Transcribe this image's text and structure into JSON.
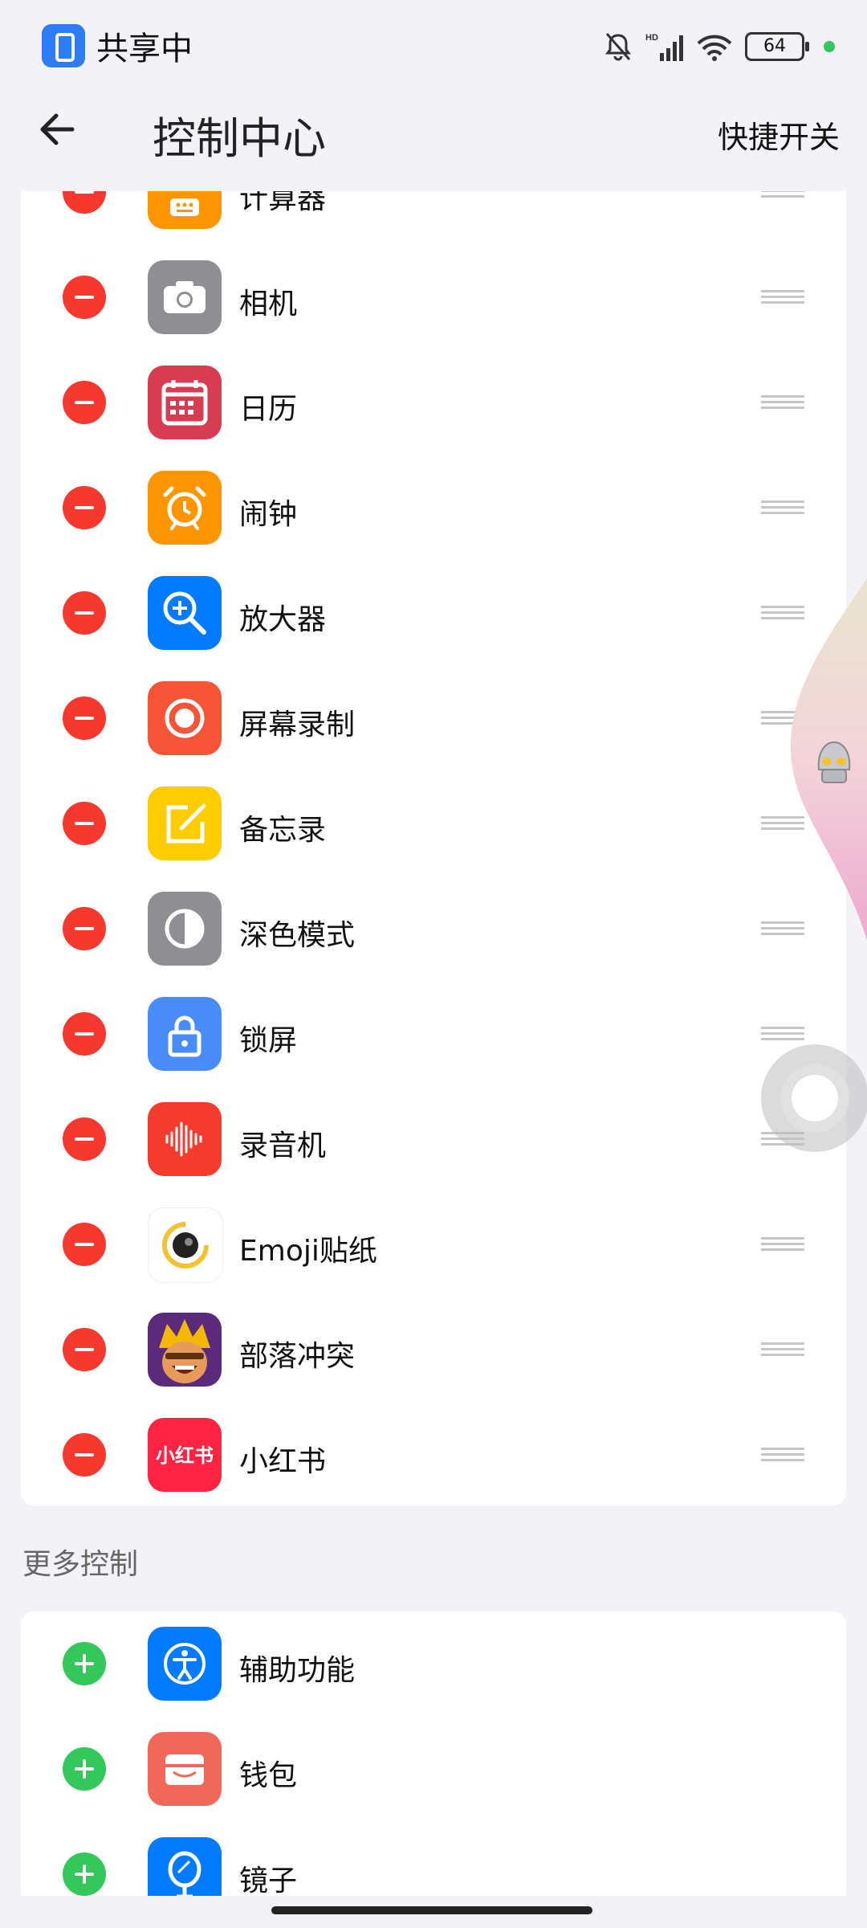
{
  "status_bar": {
    "sharing_text": "共享中",
    "hd_label": "HD",
    "battery": "64",
    "colors": {
      "share_icon": "#2f7df6",
      "recording_dot": "#34c759"
    }
  },
  "header": {
    "back_icon": "arrow-left-icon",
    "title": "控制中心",
    "action": "快捷开关"
  },
  "enabled_items": [
    {
      "label": "计算器",
      "icon": "calculator-icon",
      "color": "#ff9500"
    },
    {
      "label": "相机",
      "icon": "camera-icon",
      "color": "#8e8e93"
    },
    {
      "label": "日历",
      "icon": "calendar-icon",
      "color": "#d83c52"
    },
    {
      "label": "闹钟",
      "icon": "alarm-icon",
      "color": "#ff9500"
    },
    {
      "label": "放大器",
      "icon": "magnifier-icon",
      "color": "#007aff"
    },
    {
      "label": "屏幕录制",
      "icon": "screen-record-icon",
      "color": "#f55536"
    },
    {
      "label": "备忘录",
      "icon": "notes-icon",
      "color": "#ffcc00"
    },
    {
      "label": "深色模式",
      "icon": "dark-mode-icon",
      "color": "#8e8e93"
    },
    {
      "label": "锁屏",
      "icon": "lock-icon",
      "color": "#4a8cf7"
    },
    {
      "label": "录音机",
      "icon": "recorder-icon",
      "color": "#f53a2e"
    },
    {
      "label": "Emoji贴纸",
      "icon": "emoji-sticker-icon",
      "color": "#ffffff"
    },
    {
      "label": "部落冲突",
      "icon": "clash-of-clans-icon",
      "color": "#5a2b7a"
    },
    {
      "label": "小红书",
      "icon": "xiaohongshu-icon",
      "color": "#ff2442",
      "icon_text": "小红书"
    }
  ],
  "more_section": {
    "title": "更多控制",
    "items": [
      {
        "label": "辅助功能",
        "icon": "accessibility-icon",
        "color": "#007aff"
      },
      {
        "label": "钱包",
        "icon": "wallet-icon",
        "color": "#f0685a"
      },
      {
        "label": "镜子",
        "icon": "mirror-icon",
        "color": "#007aff"
      }
    ]
  },
  "colors": {
    "remove": "#f5392f",
    "add": "#34c759",
    "background": "#f2f2f7"
  }
}
